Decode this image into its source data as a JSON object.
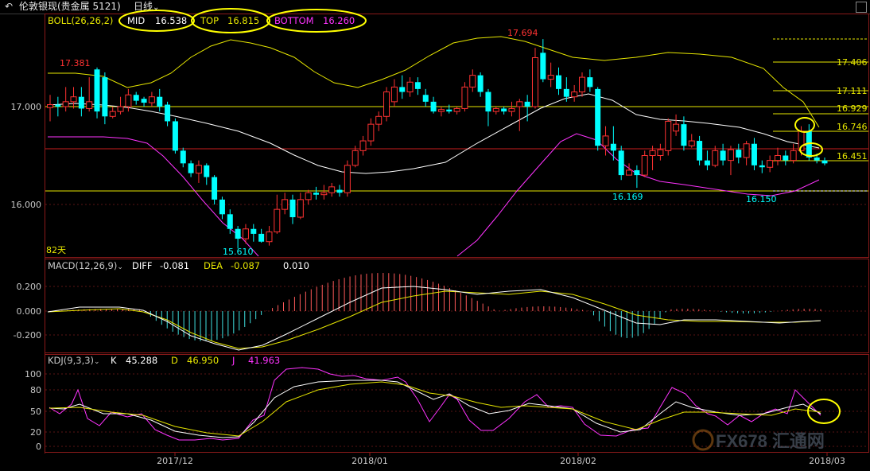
{
  "window": {
    "title": "伦敦银现(贵金属 5121)",
    "period": "日线",
    "period_icon": "chevron-down-icon",
    "back_icon": "back-arrow-icon"
  },
  "boll": {
    "label": "BOLL(26,26,2)",
    "mid_label": "MID",
    "mid_value": "16.538",
    "top_label": "TOP",
    "top_value": "16.815",
    "bottom_label": "BOTTOM",
    "bottom_value": "16.260",
    "colors": {
      "mid": "#ffffff",
      "top": "#ffff66",
      "bottom": "#ff33ff"
    }
  },
  "macd": {
    "label": "MACD(12,26,9)",
    "diff_label": "DIFF",
    "diff_value": "-0.081",
    "dea_label": "DEA",
    "dea_value": "-0.087",
    "macd_value": "0.010"
  },
  "kdj": {
    "label": "KDJ(9,3,3)",
    "k_label": "K",
    "k_value": "45.288",
    "d_label": "D",
    "d_value": "46.950",
    "j_label": "J",
    "j_value": "41.963"
  },
  "price_axis": [
    "17.000",
    "16.000"
  ],
  "macd_axis": [
    "0.200",
    "0.000",
    "-0.200"
  ],
  "kdj_axis": [
    "100",
    "80",
    "50",
    "20",
    "0"
  ],
  "date_axis": [
    "2017/12",
    "2018/01",
    "2018/02",
    "2018/03"
  ],
  "annotations": {
    "high1": "17.381",
    "high2": "17.694",
    "low1": "15.610",
    "low2": "16.169",
    "low3": "16.150",
    "days": "82天"
  },
  "fib_levels": [
    "17.406",
    "17.111",
    "16.929",
    "16.746",
    "16.451"
  ],
  "watermark": "FX678 汇通网",
  "colors": {
    "up": "#ff3232",
    "down": "#00ffff",
    "hline_yellow": "#e6e600",
    "hline_red": "#c81e1e",
    "highlight_circle": "#ffff00"
  },
  "chart_data": {
    "type": "candlestick",
    "x_ticks": [
      "2017/12",
      "2018/01",
      "2018/02",
      "2018/03"
    ],
    "y_ticks": [
      17.0,
      16.0
    ],
    "horizontal_levels": [
      17.0,
      16.929,
      16.58,
      16.14
    ],
    "candles": [
      [
        16.99,
        17.02,
        17.12,
        16.85
      ],
      [
        17.02,
        17.0,
        17.1,
        16.9
      ],
      [
        17.0,
        17.05,
        17.2,
        16.95
      ],
      [
        17.05,
        17.1,
        17.2,
        16.98
      ],
      [
        17.1,
        16.98,
        17.2,
        16.9
      ],
      [
        16.98,
        17.05,
        17.3,
        16.95
      ],
      [
        17.38,
        16.95,
        17.4,
        16.88
      ],
      [
        17.3,
        16.9,
        17.35,
        16.82
      ],
      [
        16.9,
        16.95,
        17.0,
        16.88
      ],
      [
        16.95,
        17.0,
        17.1,
        16.92
      ],
      [
        17.0,
        17.12,
        17.18,
        16.95
      ],
      [
        17.12,
        17.06,
        17.15,
        17.02
      ],
      [
        17.08,
        17.04,
        17.1,
        17.0
      ],
      [
        17.04,
        17.1,
        17.15,
        17.0
      ],
      [
        17.1,
        17.0,
        17.18,
        16.95
      ],
      [
        17.02,
        16.85,
        17.05,
        16.8
      ],
      [
        16.85,
        16.55,
        16.88,
        16.52
      ],
      [
        16.55,
        16.42,
        16.58,
        16.38
      ],
      [
        16.42,
        16.32,
        16.45,
        16.28
      ],
      [
        16.32,
        16.4,
        16.45,
        16.22
      ],
      [
        16.4,
        16.28,
        16.42,
        16.2
      ],
      [
        16.28,
        16.05,
        16.3,
        16.0
      ],
      [
        16.05,
        15.9,
        16.08,
        15.85
      ],
      [
        15.9,
        15.75,
        15.95,
        15.7
      ],
      [
        15.75,
        15.65,
        15.78,
        15.55
      ],
      [
        15.65,
        15.75,
        15.8,
        15.6
      ],
      [
        15.75,
        15.7,
        15.8,
        15.62
      ],
      [
        15.7,
        15.62,
        15.75,
        15.61
      ],
      [
        15.62,
        15.72,
        15.78,
        15.58
      ],
      [
        15.72,
        15.95,
        16.1,
        15.7
      ],
      [
        15.95,
        16.05,
        16.12,
        15.9
      ],
      [
        16.05,
        15.87,
        16.1,
        15.8
      ],
      [
        15.87,
        16.05,
        16.12,
        15.85
      ],
      [
        16.05,
        16.12,
        16.15,
        16.0
      ],
      [
        16.12,
        16.1,
        16.18,
        16.05
      ],
      [
        16.1,
        16.12,
        16.2,
        16.05
      ],
      [
        16.12,
        16.18,
        16.22,
        16.08
      ],
      [
        16.15,
        16.12,
        16.2,
        16.08
      ],
      [
        16.12,
        16.4,
        16.45,
        16.08
      ],
      [
        16.4,
        16.55,
        16.6,
        16.38
      ],
      [
        16.55,
        16.65,
        16.7,
        16.5
      ],
      [
        16.65,
        16.82,
        16.88,
        16.6
      ],
      [
        16.82,
        16.9,
        16.95,
        16.75
      ],
      [
        16.9,
        17.15,
        17.2,
        16.85
      ],
      [
        17.05,
        17.2,
        17.28,
        17.0
      ],
      [
        17.2,
        17.15,
        17.32,
        17.08
      ],
      [
        17.15,
        17.25,
        17.3,
        17.1
      ],
      [
        17.25,
        17.18,
        17.3,
        17.12
      ],
      [
        17.12,
        17.05,
        17.18,
        17.0
      ],
      [
        17.05,
        16.95,
        17.1,
        16.93
      ],
      [
        16.95,
        16.97,
        17.0,
        16.9
      ],
      [
        16.97,
        16.95,
        17.02,
        16.93
      ],
      [
        16.95,
        16.98,
        17.0,
        16.92
      ],
      [
        16.98,
        17.2,
        17.25,
        16.95
      ],
      [
        17.2,
        17.32,
        17.38,
        17.15
      ],
      [
        17.32,
        17.15,
        17.35,
        17.1
      ],
      [
        17.15,
        16.95,
        17.18,
        16.8
      ],
      [
        16.95,
        16.98,
        17.0,
        16.92
      ],
      [
        16.98,
        16.95,
        17.0,
        16.92
      ],
      [
        16.95,
        16.98,
        17.05,
        16.9
      ],
      [
        17.0,
        17.05,
        17.08,
        16.75
      ],
      [
        17.05,
        17.0,
        17.12,
        16.85
      ],
      [
        17.0,
        17.5,
        17.6,
        16.98
      ],
      [
        17.55,
        17.28,
        17.69,
        17.25
      ],
      [
        17.28,
        17.32,
        17.45,
        17.2
      ],
      [
        17.32,
        17.18,
        17.4,
        17.12
      ],
      [
        17.18,
        17.1,
        17.3,
        17.05
      ],
      [
        17.1,
        17.15,
        17.22,
        17.05
      ],
      [
        17.15,
        17.3,
        17.35,
        17.1
      ],
      [
        17.3,
        17.2,
        17.38,
        17.15
      ],
      [
        17.18,
        16.6,
        17.2,
        16.55
      ],
      [
        16.6,
        16.7,
        16.8,
        16.5
      ],
      [
        16.62,
        16.55,
        16.8,
        16.45
      ],
      [
        16.55,
        16.3,
        16.6,
        16.25
      ],
      [
        16.3,
        16.35,
        16.42,
        16.3
      ],
      [
        16.35,
        16.3,
        16.4,
        16.17
      ],
      [
        16.3,
        16.5,
        16.55,
        16.28
      ],
      [
        16.5,
        16.55,
        16.6,
        16.35
      ],
      [
        16.5,
        16.56,
        16.62,
        16.45
      ],
      [
        16.55,
        16.85,
        16.88,
        16.5
      ],
      [
        16.75,
        16.82,
        16.92,
        16.7
      ],
      [
        16.82,
        16.6,
        16.9,
        16.55
      ],
      [
        16.6,
        16.65,
        16.72,
        16.58
      ],
      [
        16.65,
        16.45,
        16.7,
        16.4
      ],
      [
        16.45,
        16.4,
        16.55,
        16.35
      ],
      [
        16.4,
        16.55,
        16.6,
        16.38
      ],
      [
        16.55,
        16.45,
        16.62,
        16.4
      ],
      [
        16.45,
        16.56,
        16.6,
        16.3
      ],
      [
        16.56,
        16.48,
        16.62,
        16.42
      ],
      [
        16.48,
        16.62,
        16.65,
        16.4
      ],
      [
        16.62,
        16.4,
        16.68,
        16.35
      ],
      [
        16.4,
        16.38,
        16.45,
        16.32
      ],
      [
        16.38,
        16.45,
        16.5,
        16.33
      ],
      [
        16.45,
        16.5,
        16.58,
        16.4
      ],
      [
        16.5,
        16.45,
        16.55,
        16.4
      ],
      [
        16.45,
        16.55,
        16.62,
        16.42
      ],
      [
        16.55,
        16.75,
        16.8,
        16.5
      ],
      [
        16.75,
        16.48,
        16.82,
        16.45
      ],
      [
        16.48,
        16.45,
        16.52,
        16.42
      ],
      [
        16.45,
        16.42,
        16.48,
        16.4
      ]
    ]
  }
}
